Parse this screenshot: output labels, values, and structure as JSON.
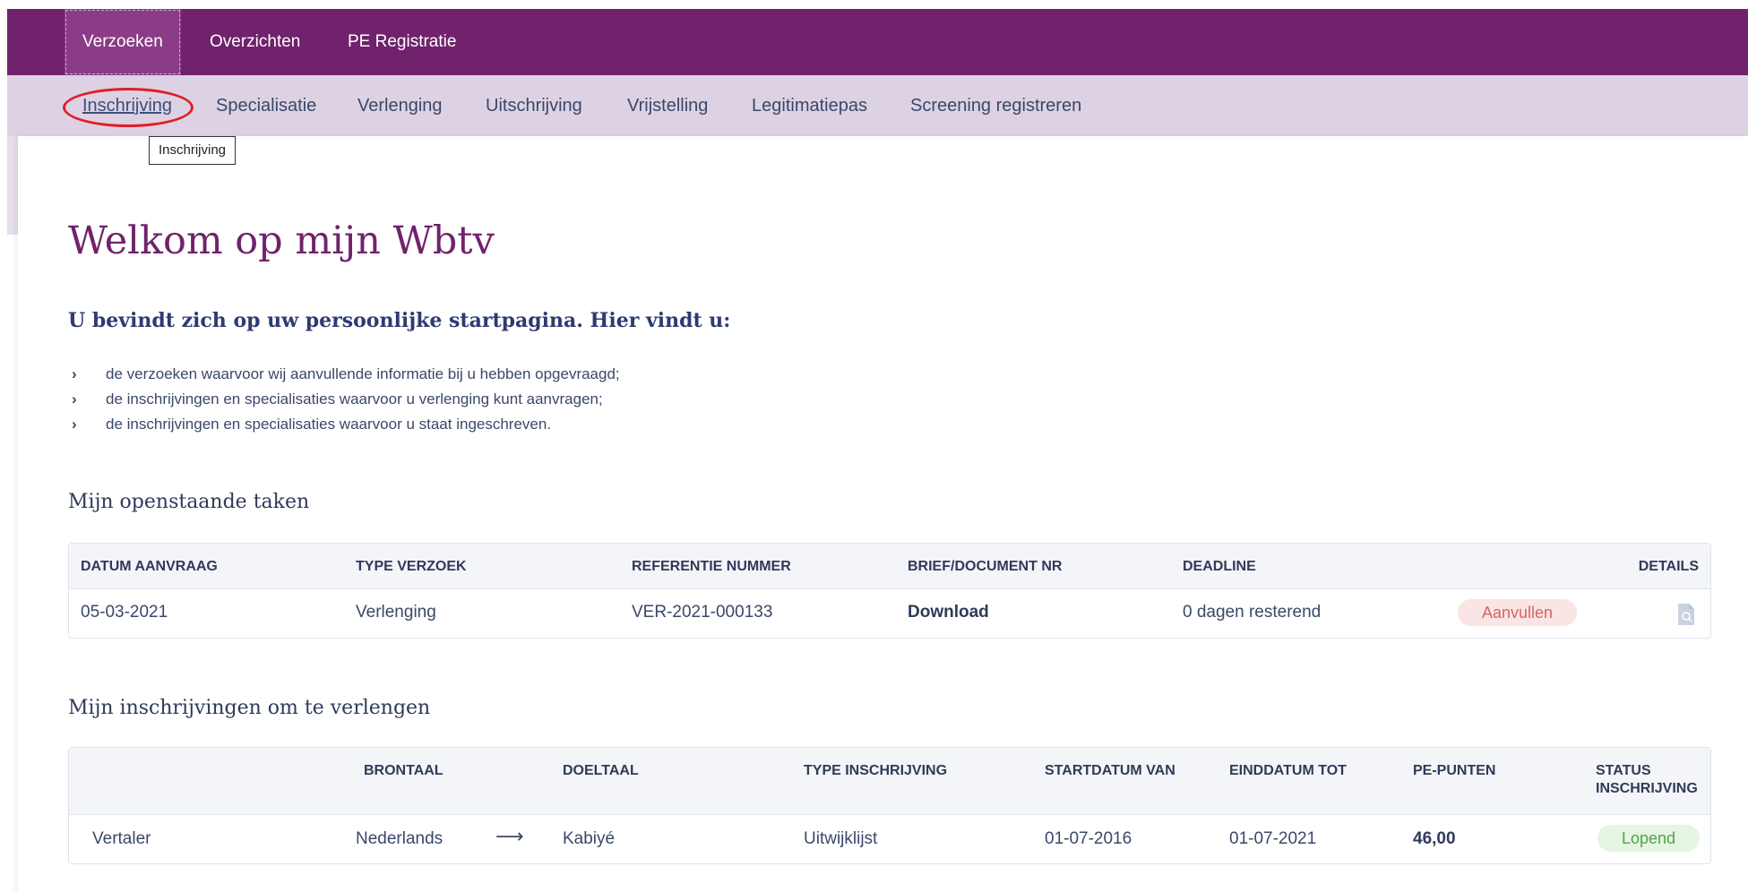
{
  "topnav": {
    "items": [
      {
        "label": "Verzoeken",
        "active": true
      },
      {
        "label": "Overzichten",
        "active": false
      },
      {
        "label": "PE Registratie",
        "active": false
      }
    ]
  },
  "subnav": {
    "items": [
      {
        "label": "Inschrijving",
        "active": true
      },
      {
        "label": "Specialisatie",
        "active": false
      },
      {
        "label": "Verlenging",
        "active": false
      },
      {
        "label": "Uitschrijving",
        "active": false
      },
      {
        "label": "Vrijstelling",
        "active": false
      },
      {
        "label": "Legitimatiepas",
        "active": false
      },
      {
        "label": "Screening registreren",
        "active": false
      }
    ],
    "tooltip": "Inschrijving"
  },
  "page": {
    "title": "Welkom op mijn Wbtv",
    "intro": "U bevindt zich op uw persoonlijke startpagina. Hier vindt u:",
    "bullets": [
      "de verzoeken waarvoor wij aanvullende informatie bij u hebben opgevraagd;",
      "de inschrijvingen en specialisaties waarvoor u verlenging kunt aanvragen;",
      "de inschrijvingen en specialisaties waarvoor u staat ingeschreven."
    ]
  },
  "tasks": {
    "title": "Mijn openstaande taken",
    "columns": [
      "DATUM AANVRAAG",
      "TYPE VERZOEK",
      "REFERENTIE NUMMER",
      "BRIEF/DOCUMENT NR",
      "DEADLINE",
      "DETAILS"
    ],
    "rows": [
      {
        "datum": "05-03-2021",
        "type": "Verlenging",
        "referentie": "VER-2021-000133",
        "document": "Download",
        "deadline": "0 dagen resterend",
        "status": "Aanvullen",
        "details_icon": "document-search-icon"
      }
    ]
  },
  "registrations": {
    "title": "Mijn inschrijvingen om te verlengen",
    "columns": [
      "BRONTAAL",
      "DOELTAAL",
      "TYPE INSCHRIJVING",
      "STARTDATUM VAN",
      "EINDDATUM TOT",
      "PE-PUNTEN",
      "STATUS INSCHRIJVING"
    ],
    "rows": [
      {
        "rol": "Vertaler",
        "brontaal": "Nederlands",
        "doeltaal": "Kabiyé",
        "type": "Uitwijklijst",
        "start": "01-07-2016",
        "eind": "01-07-2021",
        "punten": "46,00",
        "status": "Lopend"
      }
    ]
  },
  "colors": {
    "brand_purple": "#70226c",
    "subnav_bg": "#ddd2e4",
    "highlight_red": "#e01e24",
    "warn_pill": "#fbe4e4",
    "ok_pill": "#e6f4e3"
  }
}
